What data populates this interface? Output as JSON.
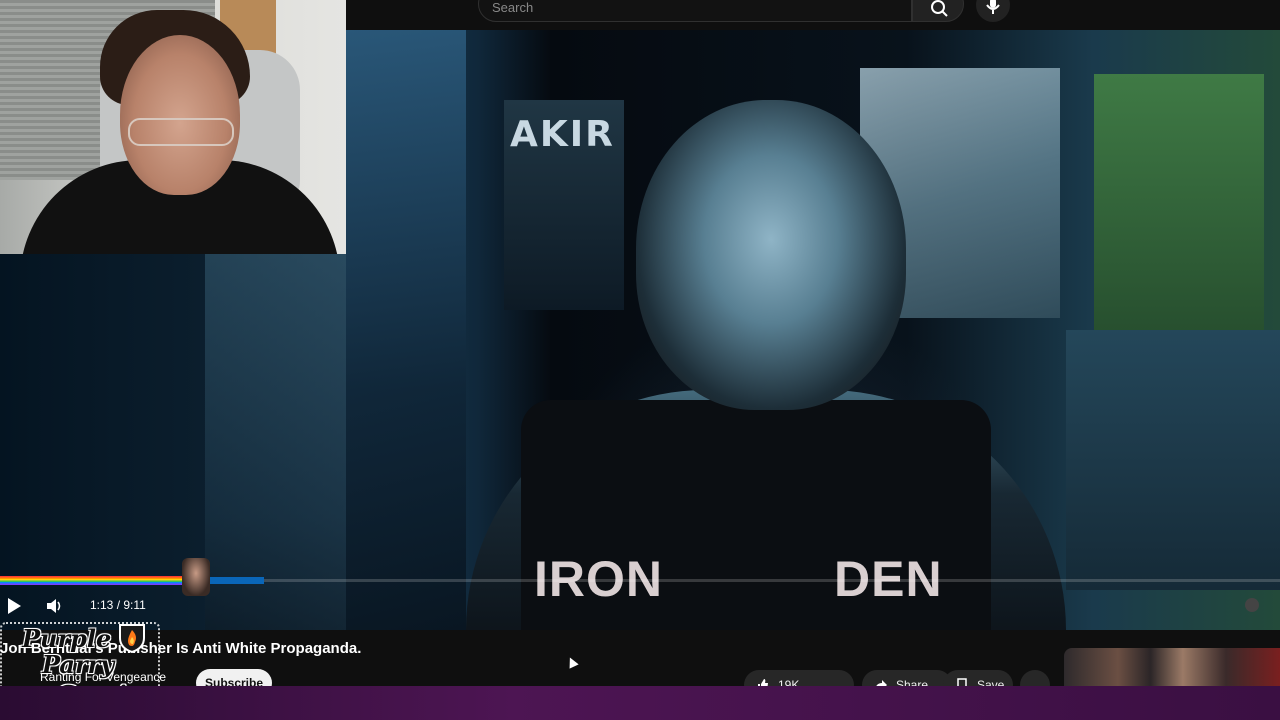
{
  "header": {
    "search_placeholder": "Search",
    "search_icon": "search-icon",
    "mic_icon": "mic-icon"
  },
  "player": {
    "time": "1:13 / 9:11",
    "progress_fraction": 0.133,
    "play_icon": "play-icon",
    "volume_icon": "volume-icon",
    "shirt_text_left": "IRON",
    "shirt_text_right": "DEN",
    "poster_text": "AKIR"
  },
  "video": {
    "title": "Jon Bernthal's Punisher Is Anti White Propaganda.",
    "channel": "Ranting For Vengeance",
    "subscribe_label": "Subscribe",
    "likes": "19K",
    "share_label": "Share",
    "save_label": "Save",
    "more_label": "…"
  },
  "overlay_logo": {
    "line1": "Purple",
    "line2": "Parry",
    "line3": "Gaming"
  },
  "colors": {
    "accent": "#0a84ff",
    "background": "#0f0f0f",
    "bottom_strip": "#4d1553"
  }
}
